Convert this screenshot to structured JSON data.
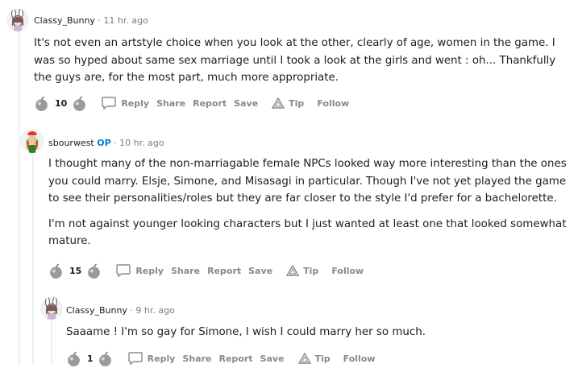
{
  "comments": [
    {
      "author": "Classy_Bunny",
      "op": "",
      "time": "11 hr. ago",
      "paragraphs": [
        "It's not even an artstyle choice when you look at the other, clearly of age, women in the game. I was so hyped about same sex marriage until I took a look at the girls and went : oh... Thankfully the guys are, for the most part, much more appropriate."
      ],
      "score": "10"
    },
    {
      "author": "sbourwest",
      "op": "OP",
      "time": "10 hr. ago",
      "paragraphs": [
        "I thought many of the non-marriagable female NPCs looked way more interesting than the ones you could marry. Elsje, Simone, and Misasagi in particular. Though I've not yet played the game to see their personalities/roles but they are far closer to the style I'd prefer for a bachelorette.",
        "I'm not against younger looking characters but I just wanted at least one that looked somewhat mature."
      ],
      "score": "15"
    },
    {
      "author": "Classy_Bunny",
      "op": "",
      "time": "9 hr. ago",
      "paragraphs": [
        "Saaame ! I'm so gay for Simone, I wish I could marry her so much."
      ],
      "score": "1"
    }
  ],
  "actions": {
    "reply": "Reply",
    "share": "Share",
    "report": "Report",
    "save": "Save",
    "tip": "Tip",
    "follow": "Follow"
  },
  "meta": {
    "separator": "·"
  },
  "colors": {
    "op": "#0079d3",
    "muted": "#878a8c",
    "thread_line": "#edeff1"
  },
  "icons": [
    "apple-upvote-icon",
    "apple-downvote-icon",
    "reply-bubble-icon",
    "tip-triangle-icon",
    "avatar-icon"
  ]
}
